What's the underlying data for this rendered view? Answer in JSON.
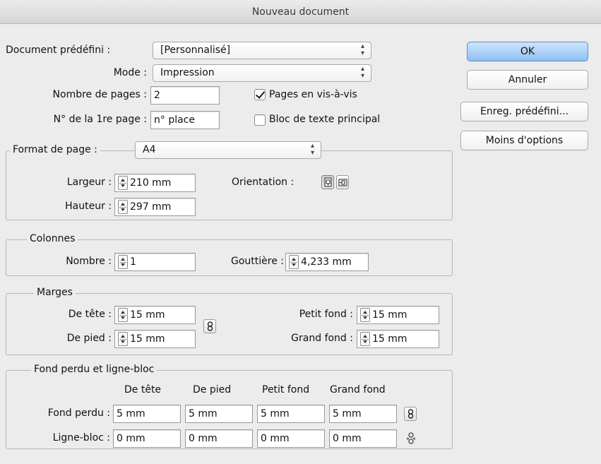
{
  "window": {
    "title": "Nouveau document"
  },
  "top": {
    "preset_label": "Document prédéfini :",
    "preset_value": "[Personnalisé]",
    "mode_label": "Mode :",
    "mode_value": "Impression",
    "pages_label": "Nombre de pages :",
    "pages_value": "2",
    "first_page_label": "N° de la 1re page :",
    "first_page_value": "n° place",
    "facing_pages_label": "Pages en vis-à-vis",
    "facing_pages_checked": true,
    "master_text_label": "Bloc de texte principal",
    "master_text_checked": false
  },
  "buttons": {
    "ok": "OK",
    "cancel": "Annuler",
    "save_preset": "Enreg. prédéfini...",
    "fewer_options": "Moins d'options"
  },
  "page_size": {
    "label": "Format de page :",
    "value": "A4",
    "width_label": "Largeur :",
    "width_value": "210 mm",
    "height_label": "Hauteur :",
    "height_value": "297 mm",
    "orientation_label": "Orientation :",
    "orientation_selected": "portrait",
    "icons": [
      "portrait-orientation-icon",
      "landscape-orientation-icon"
    ]
  },
  "columns": {
    "title": "Colonnes",
    "number_label": "Nombre :",
    "number_value": "1",
    "gutter_label": "Gouttière :",
    "gutter_value": "4,233 mm"
  },
  "margins": {
    "title": "Marges",
    "top_label": "De tête :",
    "top_value": "15 mm",
    "bottom_label": "De pied :",
    "bottom_value": "15 mm",
    "inside_label": "Petit fond :",
    "inside_value": "15 mm",
    "outside_label": "Grand fond :",
    "outside_value": "15 mm",
    "link_icon": "chain-link-icon"
  },
  "bleed": {
    "title": "Fond perdu et ligne-bloc",
    "headers": [
      "De tête",
      "De pied",
      "Petit fond",
      "Grand fond"
    ],
    "rows": [
      {
        "label": "Fond perdu :",
        "values": [
          "5 mm",
          "5 mm",
          "5 mm",
          "5 mm"
        ],
        "link": "linked"
      },
      {
        "label": "Ligne-bloc :",
        "values": [
          "0 mm",
          "0 mm",
          "0 mm",
          "0 mm"
        ],
        "link": "unlinked"
      }
    ]
  },
  "colors": {
    "primary_button": "#8ec0f2",
    "background": "#ececec"
  }
}
